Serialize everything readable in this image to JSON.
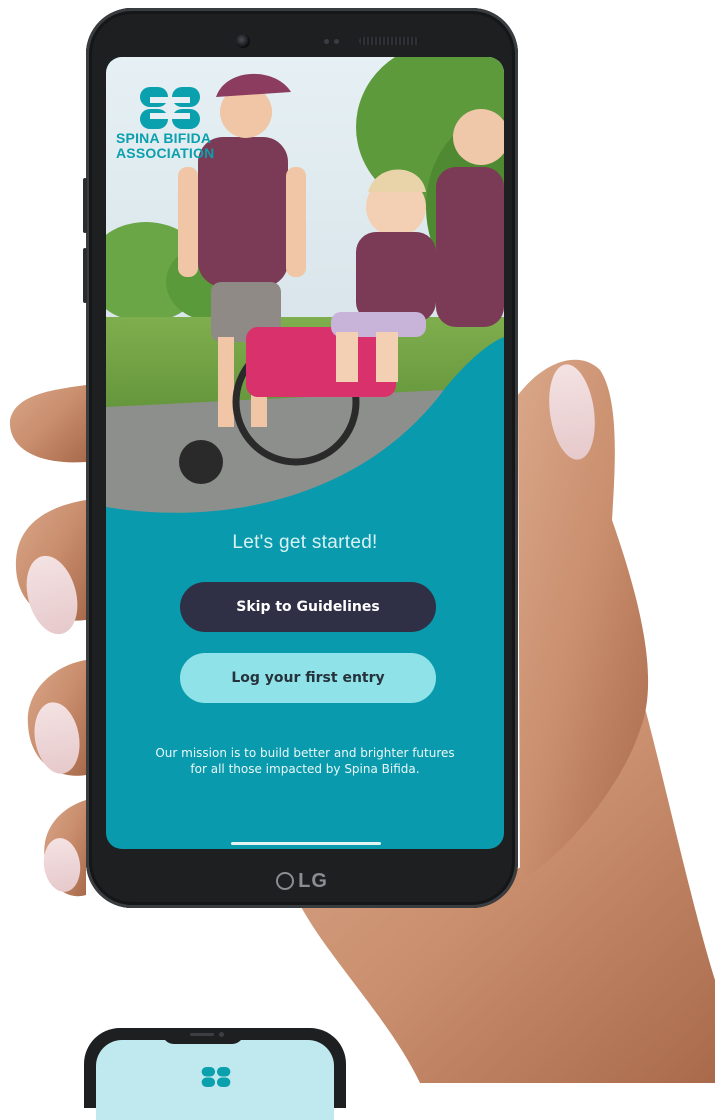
{
  "app": {
    "organization_line1": "SPINA BIFIDA",
    "organization_line2": "ASSOCIATION",
    "device_brand": "LG"
  },
  "onboarding": {
    "heading": "Let's get started!",
    "primary_button": "Skip to Guidelines",
    "secondary_button": "Log your first entry",
    "mission_line1": "Our mission is to build better and brighter futures",
    "mission_line2": "for all those impacted by Spina Bifida."
  },
  "colors": {
    "teal_background": "#0a9aad",
    "dark_button": "#2f3046",
    "light_button": "#8fe3e8",
    "logo_teal": "#0aa0ad"
  },
  "icons": [
    "spina-bifida-logo-icon",
    "lg-logo-icon",
    "camera-icon"
  ]
}
